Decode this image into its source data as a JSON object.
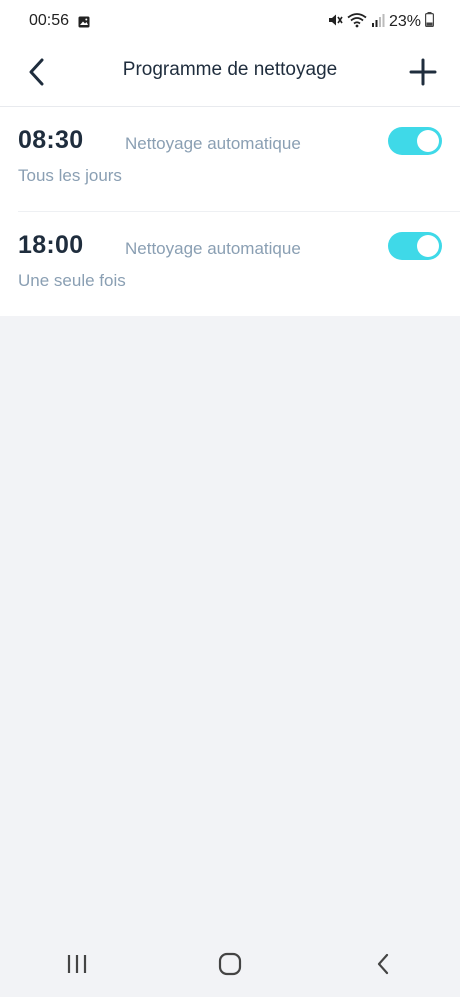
{
  "status_bar": {
    "time": "00:56",
    "battery": "23%"
  },
  "header": {
    "title": "Programme de nettoyage"
  },
  "schedules": [
    {
      "time": "08:30",
      "mode": "Nettoyage automatique",
      "repeat": "Tous les jours",
      "enabled": true
    },
    {
      "time": "18:00",
      "mode": "Nettoyage automatique",
      "repeat": "Une seule fois",
      "enabled": true
    }
  ],
  "icons": {
    "back": "chevron-left-icon",
    "add": "plus-icon",
    "nav_recents": "recent-apps-icon",
    "nav_home": "home-icon",
    "nav_back": "back-icon"
  },
  "colors": {
    "accent": "#3fd9e8",
    "title": "#1f2d3d",
    "secondary_text": "#8a9fb3",
    "background": "#f2f3f6"
  }
}
